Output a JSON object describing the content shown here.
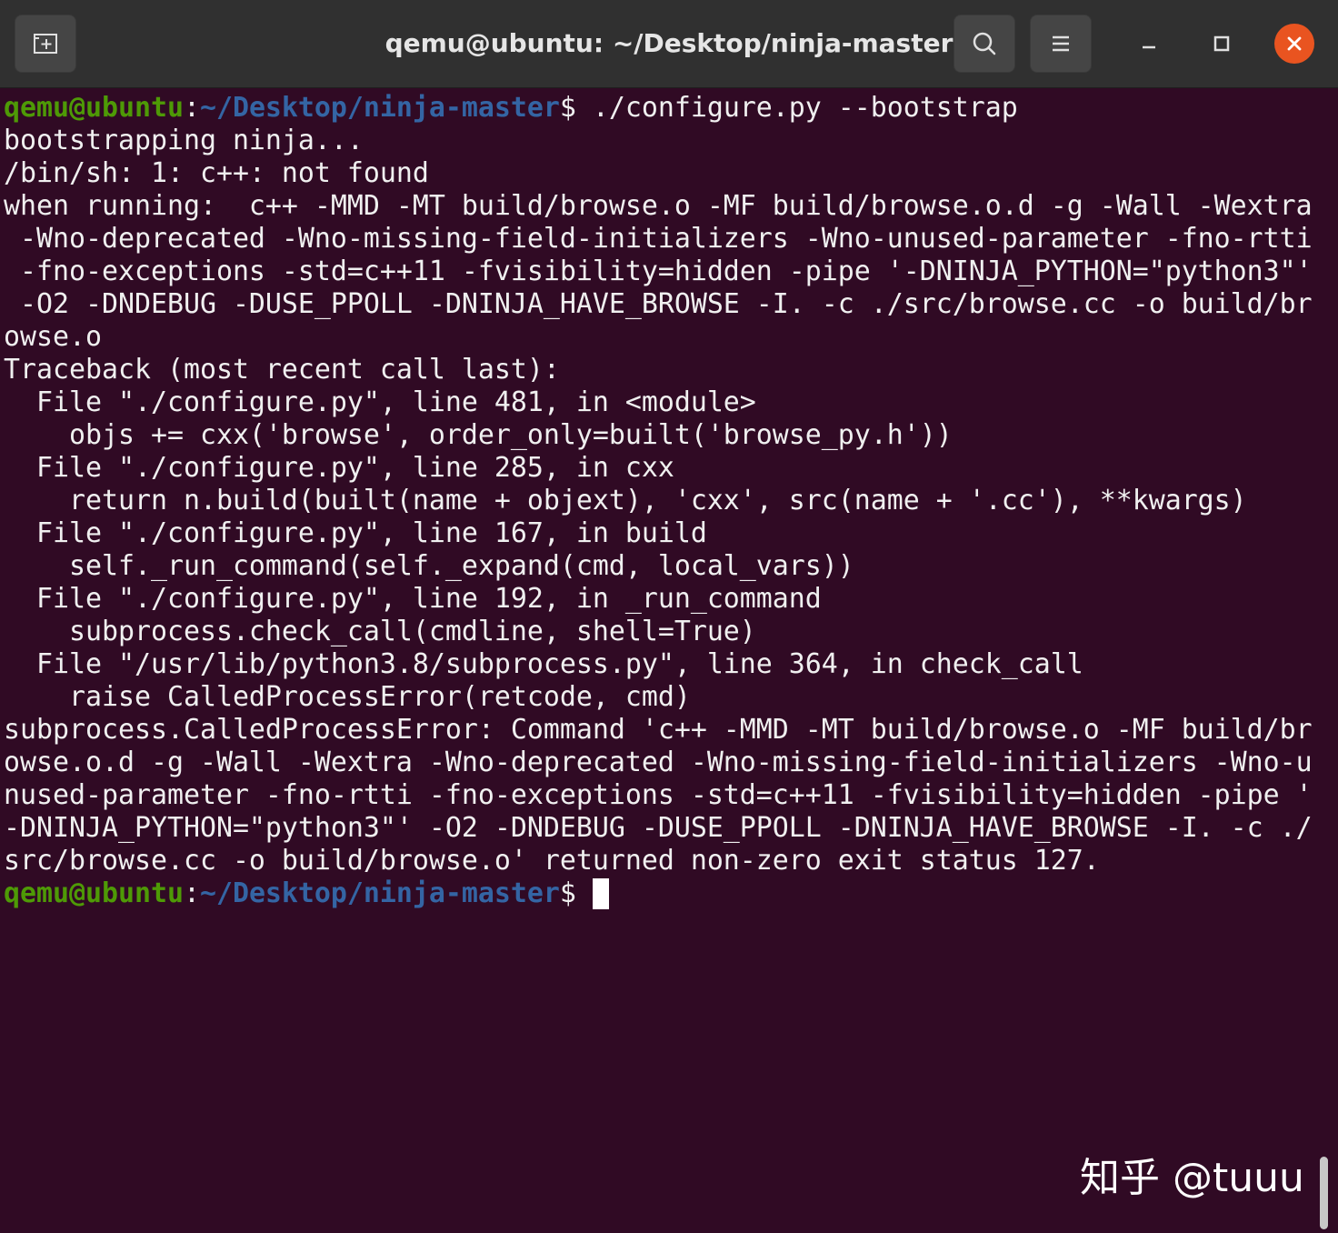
{
  "window": {
    "title": "qemu@ubuntu: ~/Desktop/ninja-master"
  },
  "header": {
    "new_tab_icon": "new-tab-icon",
    "search_icon": "search-icon",
    "menu_icon": "hamburger-menu-icon",
    "minimize_icon": "minimize-icon",
    "maximize_icon": "maximize-icon",
    "close_icon": "close-icon"
  },
  "prompt": {
    "user_host": "qemu@ubuntu",
    "colon": ":",
    "path": "~/Desktop/ninja-master",
    "symbol": "$"
  },
  "command": " ./configure.py --bootstrap",
  "output_lines": [
    "bootstrapping ninja...",
    "/bin/sh: 1: c++: not found",
    "when running:  c++ -MMD -MT build/browse.o -MF build/browse.o.d -g -Wall -Wextra",
    " -Wno-deprecated -Wno-missing-field-initializers -Wno-unused-parameter -fno-rtti",
    " -fno-exceptions -std=c++11 -fvisibility=hidden -pipe '-DNINJA_PYTHON=\"python3\"'",
    " -O2 -DNDEBUG -DUSE_PPOLL -DNINJA_HAVE_BROWSE -I. -c ./src/browse.cc -o build/br",
    "owse.o",
    "Traceback (most recent call last):",
    "  File \"./configure.py\", line 481, in <module>",
    "    objs += cxx('browse', order_only=built('browse_py.h'))",
    "  File \"./configure.py\", line 285, in cxx",
    "    return n.build(built(name + objext), 'cxx', src(name + '.cc'), **kwargs)",
    "  File \"./configure.py\", line 167, in build",
    "    self._run_command(self._expand(cmd, local_vars))",
    "  File \"./configure.py\", line 192, in _run_command",
    "    subprocess.check_call(cmdline, shell=True)",
    "  File \"/usr/lib/python3.8/subprocess.py\", line 364, in check_call",
    "    raise CalledProcessError(retcode, cmd)",
    "subprocess.CalledProcessError: Command 'c++ -MMD -MT build/browse.o -MF build/br",
    "owse.o.d -g -Wall -Wextra -Wno-deprecated -Wno-missing-field-initializers -Wno-u",
    "nused-parameter -fno-rtti -fno-exceptions -std=c++11 -fvisibility=hidden -pipe '",
    "-DNINJA_PYTHON=\"python3\"' -O2 -DNDEBUG -DUSE_PPOLL -DNINJA_HAVE_BROWSE -I. -c ./",
    "src/browse.cc -o build/browse.o' returned non-zero exit status 127."
  ],
  "watermark": "知乎 @tuuu",
  "colors": {
    "background": "#300a24",
    "prompt_user": "#4e9a06",
    "prompt_path": "#3465a4",
    "text": "#f0f0f0",
    "close_button": "#e95420"
  }
}
